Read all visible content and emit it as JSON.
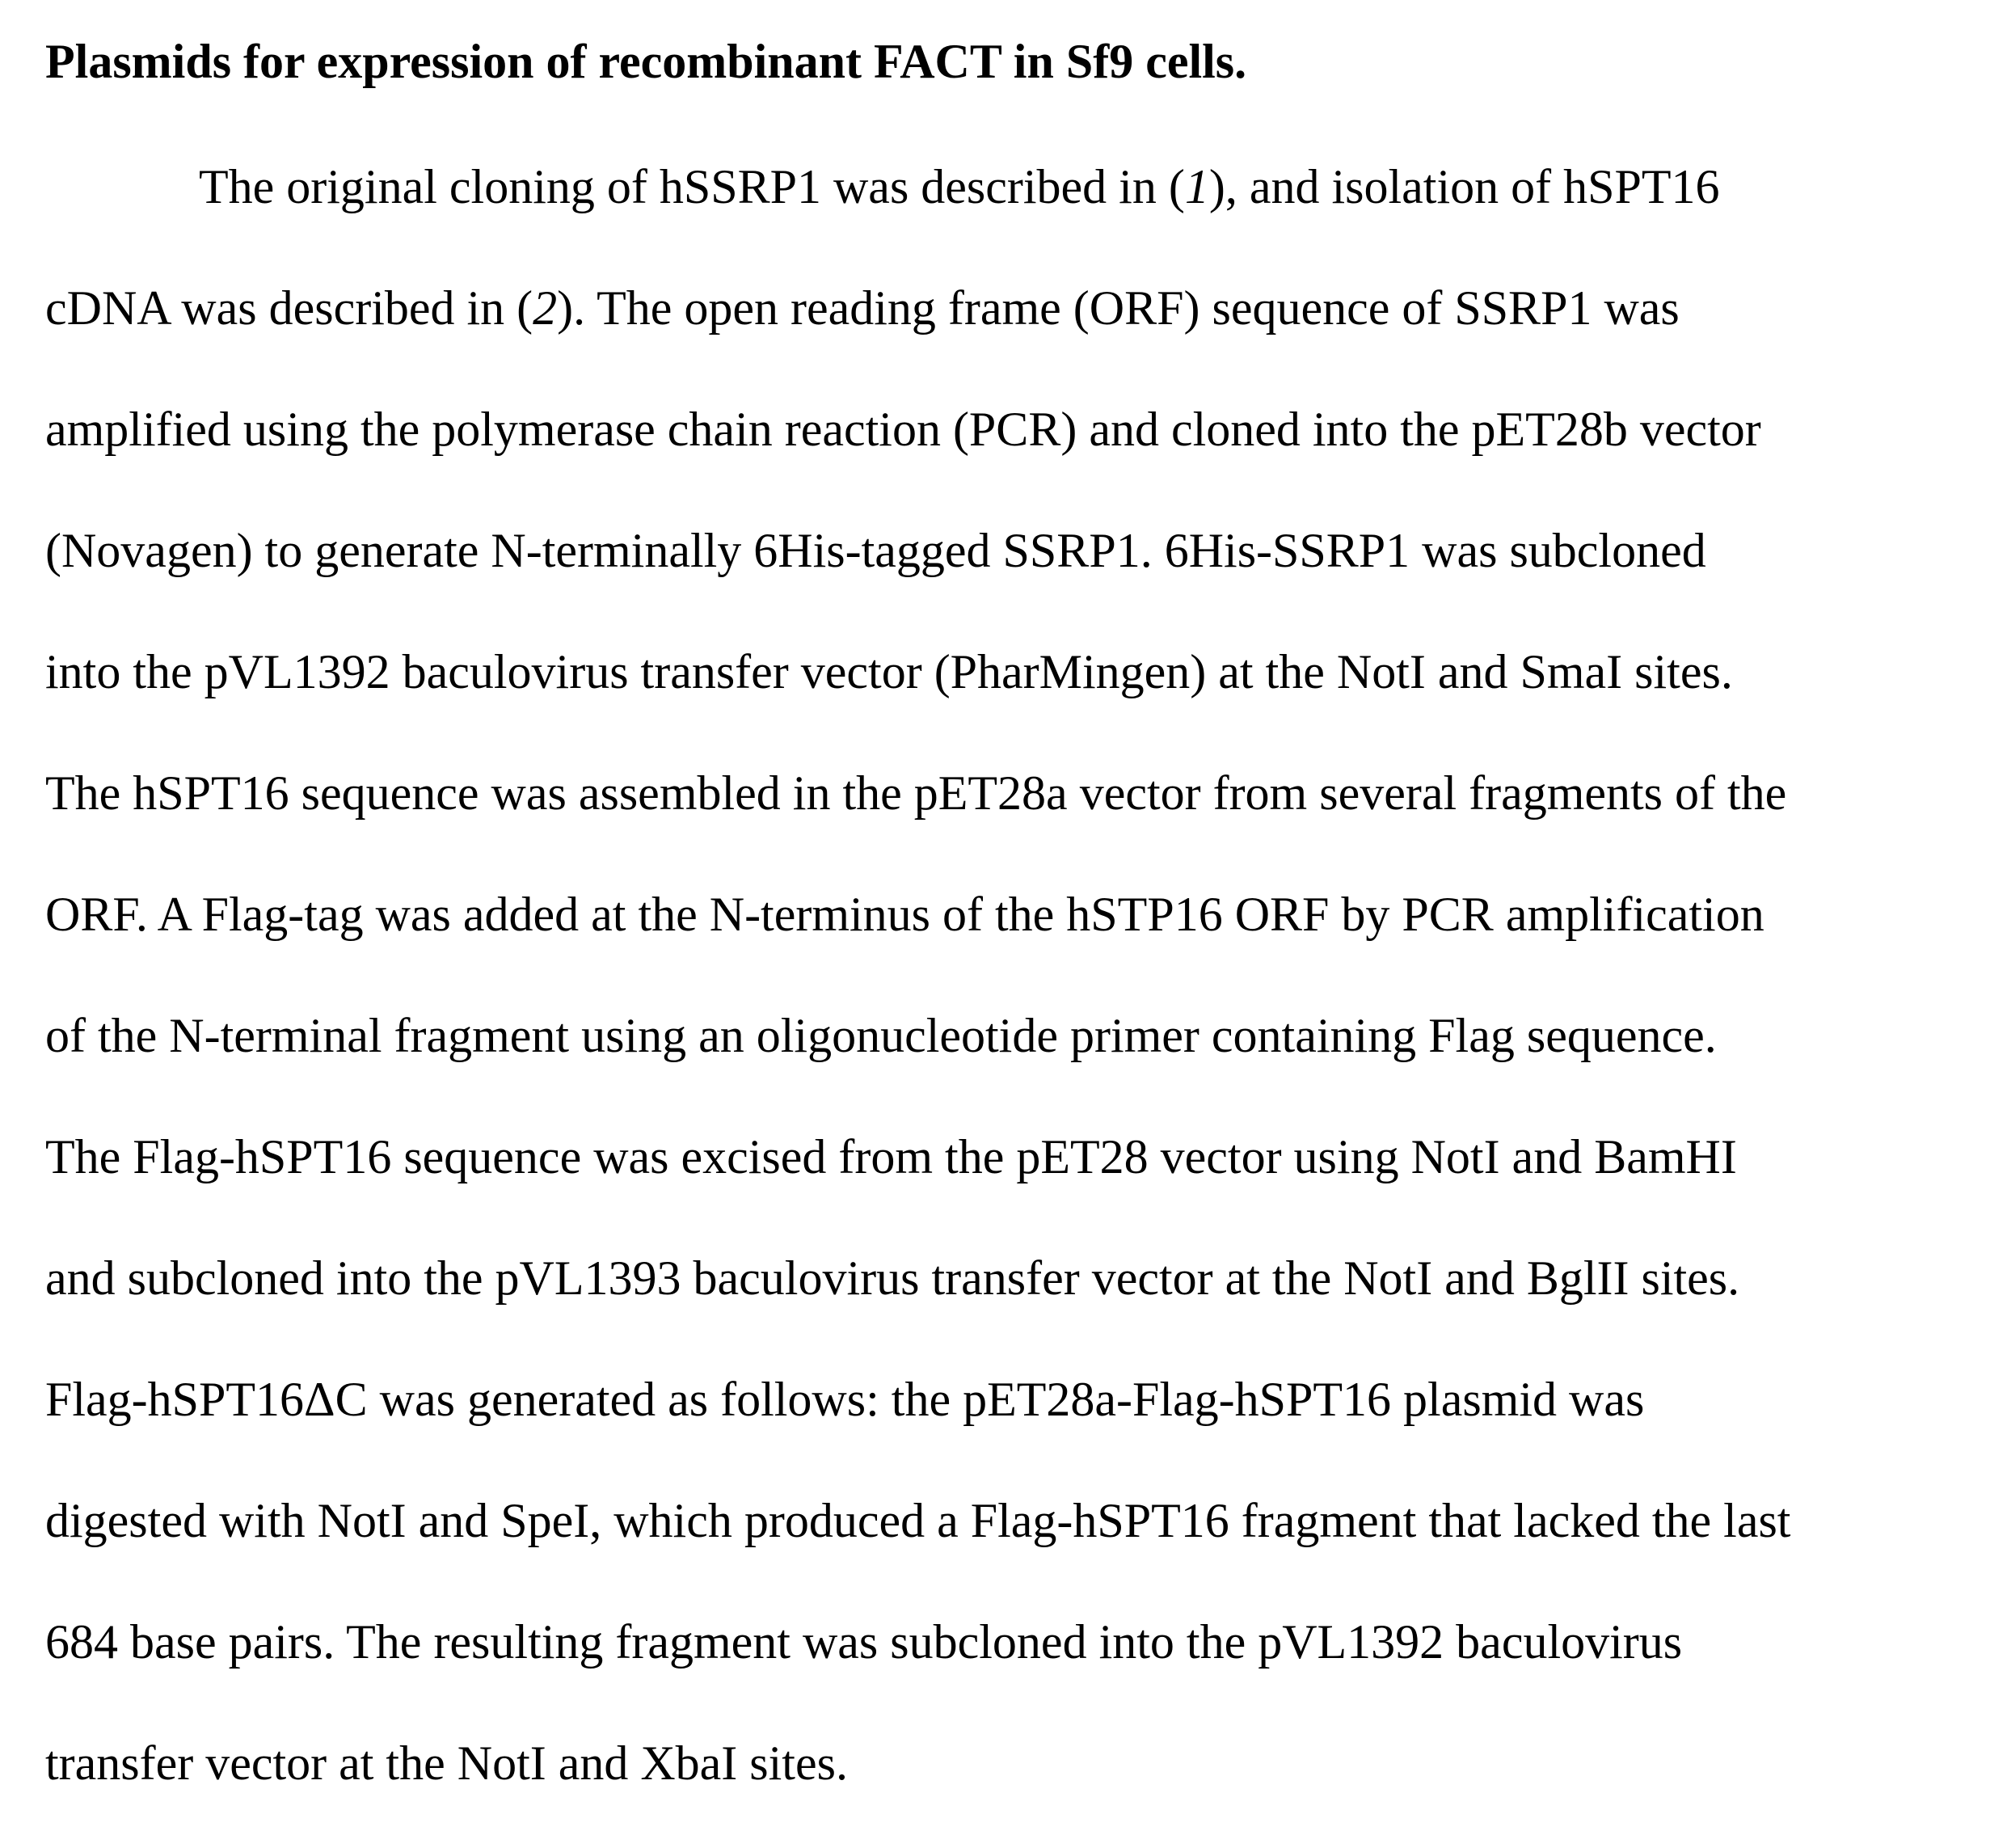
{
  "heading": "Plasmids for expression of recombinant FACT in Sf9 cells.",
  "lines": [
    {
      "parts": [
        "The original cloning of hSSRP1 was described in (",
        "1",
        "), and isolation of hSPT16"
      ]
    },
    {
      "parts": [
        "cDNA was described in (",
        "2",
        "). The open reading frame (ORF) sequence of SSRP1 was"
      ]
    },
    {
      "text": "amplified using the polymerase chain reaction (PCR) and cloned into the pET28b vector"
    },
    {
      "text": "(Novagen) to generate N-terminally 6His-tagged SSRP1. 6His-SSRP1 was subcloned"
    },
    {
      "text": "into the pVL1392 baculovirus transfer vector (PharMingen) at the NotI and SmaI sites."
    },
    {
      "text": "The hSPT16 sequence was assembled in the pET28a vector from several fragments of the"
    },
    {
      "text": "ORF. A Flag-tag was added at the N-terminus of the hSTP16 ORF by PCR amplification"
    },
    {
      "text": "of the N-terminal fragment using an oligonucleotide primer containing Flag sequence."
    },
    {
      "text": "The Flag-hSPT16 sequence was excised from the pET28 vector using NotI and BamHI"
    },
    {
      "text": "and subcloned into the pVL1393 baculovirus transfer vector at the NotI and BglII sites."
    },
    {
      "text": "Flag-hSPT16ΔC was generated as follows: the pET28a-Flag-hSPT16 plasmid was"
    },
    {
      "text": "digested with NotI and SpeI, which produced a Flag-hSPT16 fragment that lacked the last"
    },
    {
      "text": "684 base pairs. The resulting fragment was subcloned into the pVL1392 baculovirus"
    },
    {
      "text": "transfer vector at the NotI and XbaI sites."
    }
  ]
}
